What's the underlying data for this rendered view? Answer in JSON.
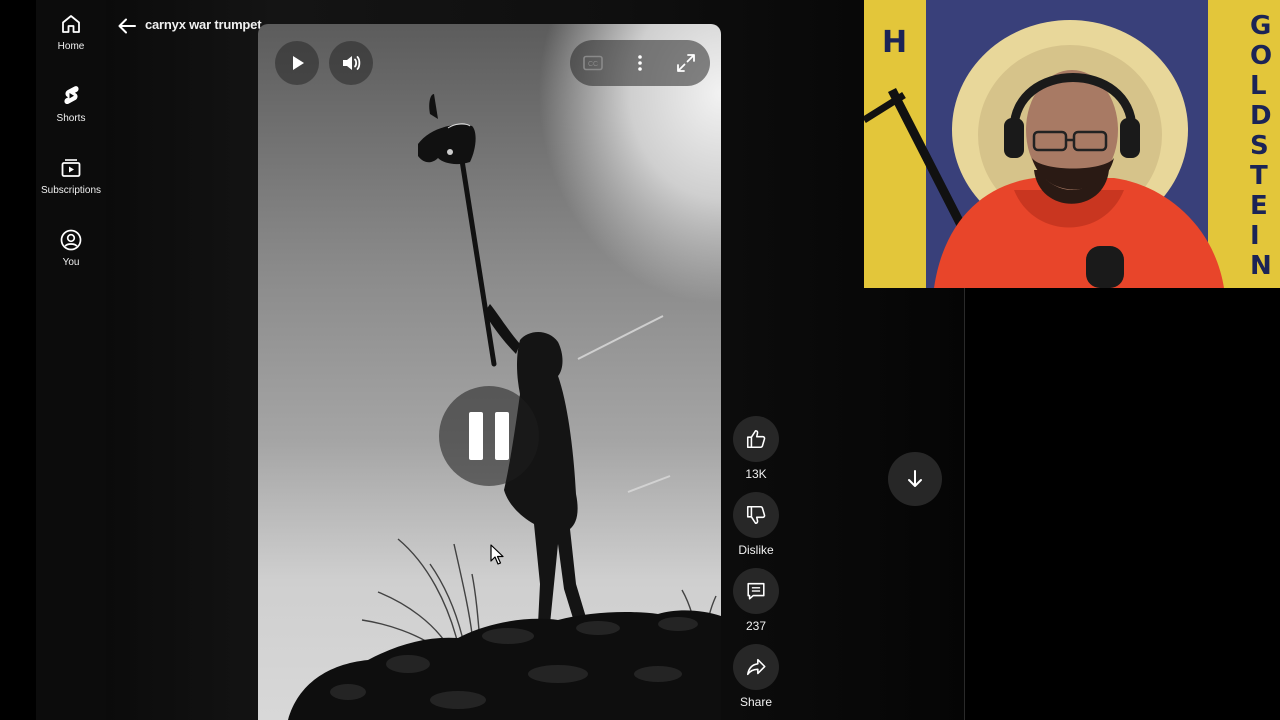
{
  "sidebar": {
    "items": [
      {
        "label": "Home",
        "icon": "home-icon"
      },
      {
        "label": "Shorts",
        "icon": "shorts-icon"
      },
      {
        "label": "Subscriptions",
        "icon": "subscriptions-icon"
      },
      {
        "label": "You",
        "icon": "account-icon"
      }
    ]
  },
  "header": {
    "search_query": "carnyx war trumpet"
  },
  "player": {
    "state": "paused",
    "controls": [
      "play-icon",
      "volume-icon",
      "cc-icon",
      "more-vert-icon",
      "fullscreen-icon"
    ]
  },
  "actions": {
    "like_count": "13K",
    "dislike_label": "Dislike",
    "comments_count": "237",
    "share_label": "Share"
  },
  "webcam": {
    "banner_left_letters": [
      "H"
    ],
    "banner_right_letters": [
      "G",
      "O",
      "L",
      "D",
      "S",
      "T",
      "E",
      "I",
      "N"
    ]
  },
  "colors": {
    "background": "#000000",
    "button_bg": "#272727",
    "text": "#f1f1f1",
    "hoodie": "#e8452a",
    "banner_yellow": "#e3c63a"
  }
}
